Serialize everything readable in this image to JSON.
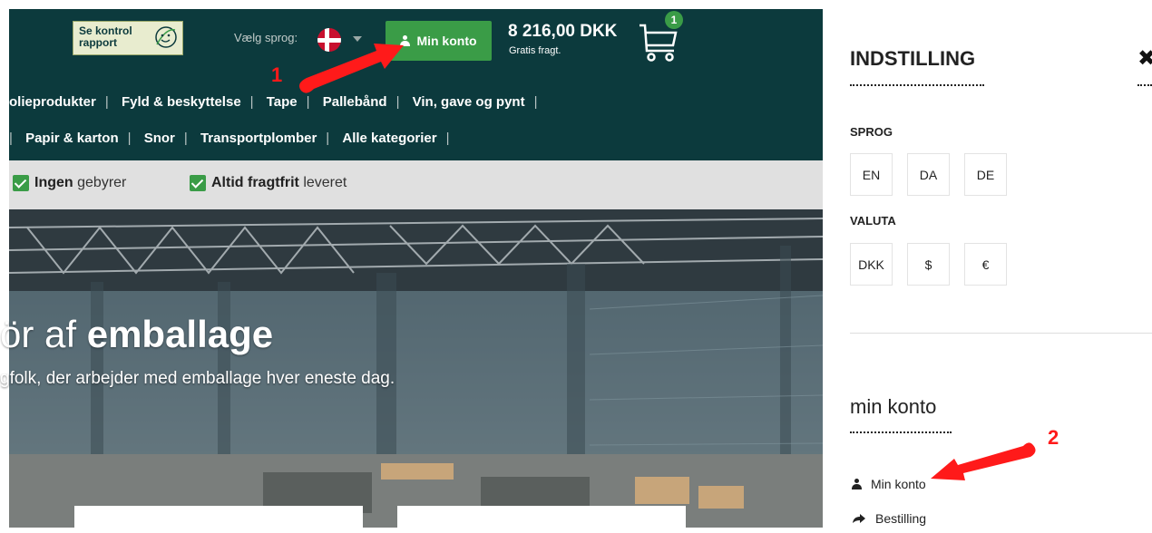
{
  "header": {
    "logo_text": "Se kontrol rapport",
    "language_label": "Vælg sprog:",
    "account_button": "Min konto",
    "cart_total": "8 216,00 DKK",
    "cart_subtext": "Gratis fragt.",
    "cart_count": "1"
  },
  "nav": {
    "row1": [
      "olieprodukter",
      "Fyld & beskyttelse",
      "Tape",
      "Pallebånd",
      "Vin, gave og pynt"
    ],
    "row2": [
      "Papir & karton",
      "Snor",
      "Transportplomber",
      "Alle kategorier"
    ]
  },
  "usp": {
    "item1_bold": "Ingen",
    "item1_rest": " gebyrer",
    "item2_bold": "Altid fragtfrit",
    "item2_rest": " leveret"
  },
  "hero": {
    "title_prefix": "ör af ",
    "title_bold": "emballage",
    "subtitle": "gfolk, der arbejder med emballage hver eneste dag."
  },
  "settings": {
    "title": "INDSTILLING",
    "close_icon": "close-icon",
    "language_label": "SPROG",
    "languages": [
      "EN",
      "DA",
      "DE"
    ],
    "currency_label": "VALUTA",
    "currencies": [
      "DKK",
      "$",
      "€"
    ]
  },
  "account": {
    "title": "min konto",
    "items": [
      {
        "label": "Min konto",
        "icon": "user-icon"
      },
      {
        "label": "Bestilling",
        "icon": "share-icon"
      }
    ]
  },
  "annotations": {
    "label1": "1",
    "label2": "2",
    "color": "#ff1a1a"
  },
  "colors": {
    "header_bg": "#0c3a3d",
    "accent_green": "#3a9c47"
  }
}
